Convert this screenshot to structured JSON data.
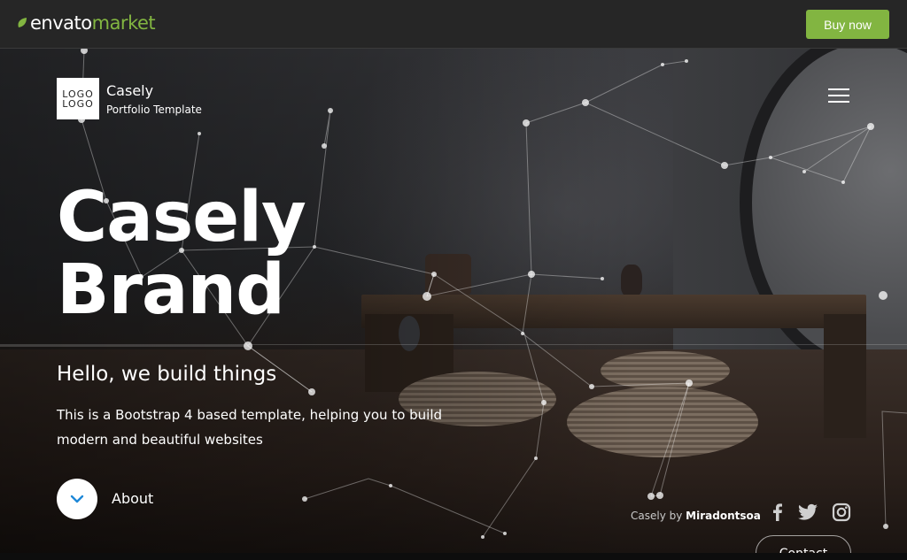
{
  "envato_bar": {
    "logo_word1": "envato",
    "logo_word2": "market",
    "buy_label": "Buy now",
    "accent": "#82b541"
  },
  "header": {
    "logo_line1": "LOGO",
    "logo_line2": "LOGO",
    "site_name": "Casely",
    "site_subtitle": "Portfolio Template",
    "menu_icon": "hamburger-menu-icon"
  },
  "hero": {
    "title_line1": "Casely",
    "title_line2": "Brand",
    "tagline": "Hello, we build things",
    "description": "This is a Bootstrap 4 based template, helping you to build modern and beautiful websites",
    "about_label": "About",
    "about_icon": "chevron-down-icon"
  },
  "footer": {
    "credit_prefix": "Casely by",
    "credit_author": "Miradontsoa",
    "social": [
      "facebook-icon",
      "twitter-icon",
      "instagram-icon"
    ],
    "contact_label": "Contact"
  }
}
